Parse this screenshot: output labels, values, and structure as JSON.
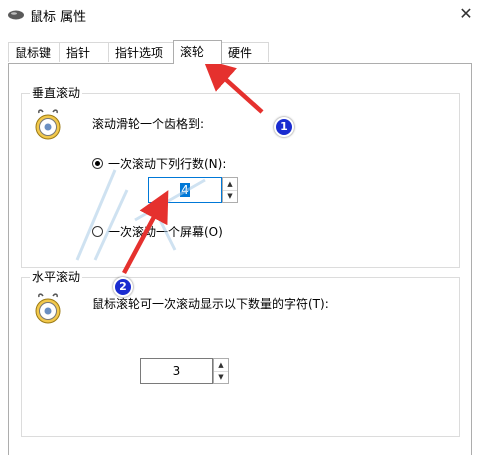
{
  "window": {
    "title": "鼠标 属性",
    "close_glyph": "✕"
  },
  "tabs": [
    {
      "label": "鼠标键"
    },
    {
      "label": "指针"
    },
    {
      "label": "指针选项"
    },
    {
      "label": "滚轮",
      "active": true
    },
    {
      "label": "硬件"
    }
  ],
  "vertical": {
    "legend": "垂直滚动",
    "description": "滚动滑轮一个齿格到:",
    "option_lines": "一次滚动下列行数(N):",
    "lines_value": "4",
    "option_screen": "一次滚动一个屏幕(O)"
  },
  "horizontal": {
    "legend": "水平滚动",
    "description": "鼠标滚轮可一次滚动显示以下数量的字符(T):",
    "chars_value": "3"
  },
  "annotations": {
    "badge1": "1",
    "badge2": "2",
    "arrow_color": "#e5312e",
    "badge_color": "#1a2cd0"
  },
  "icons": {
    "app": "mouse-icon",
    "wheel": "scroll-wheel-mouse-icon"
  }
}
